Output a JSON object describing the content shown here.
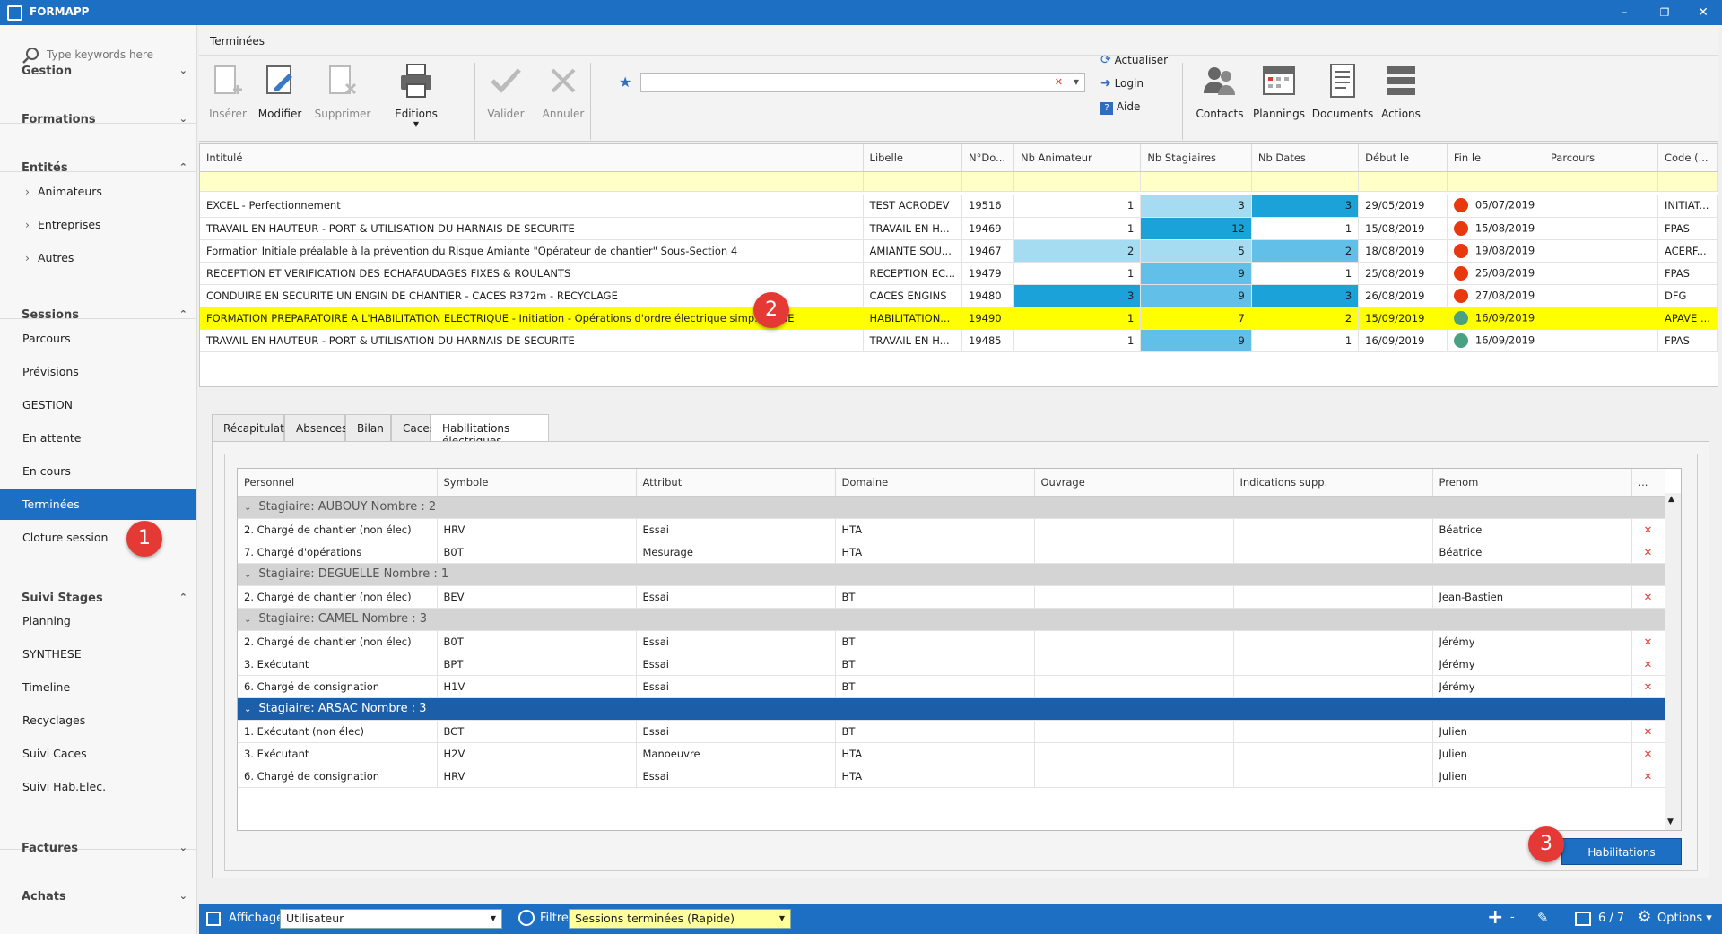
{
  "app": {
    "title": "FORMAPP",
    "window_controls": {
      "minimize": "–",
      "restore": "❐",
      "close": "✕"
    }
  },
  "sidebar": {
    "search_placeholder": "Type keywords here",
    "groups": [
      {
        "label": "Gestion",
        "state": "collapsed"
      },
      {
        "label": "Formations",
        "state": "collapsed"
      },
      {
        "label": "Entités",
        "state": "expanded",
        "items": [
          "Animateurs",
          "Entreprises",
          "Autres"
        ]
      },
      {
        "label": "Sessions",
        "state": "expanded",
        "items": [
          "Parcours",
          "Prévisions",
          "GESTION",
          "En attente",
          "En cours",
          "Terminées",
          "Cloture session"
        ]
      },
      {
        "label": "Suivi Stages",
        "state": "expanded",
        "items": [
          "Planning",
          "SYNTHESE",
          "Timeline",
          "Recyclages",
          "Suivi Caces",
          "Suivi Hab.Elec."
        ]
      },
      {
        "label": "Factures",
        "state": "collapsed"
      },
      {
        "label": "Achats",
        "state": "collapsed"
      }
    ],
    "active_item": "Terminées"
  },
  "breadcrumb": "Terminées",
  "ribbon": {
    "buttons": [
      "Insérer",
      "Modifier",
      "Supprimer",
      "Editions",
      "Valider",
      "Annuler"
    ],
    "small_actions": [
      "Actualiser",
      "Login",
      "Aide"
    ],
    "right_buttons": [
      "Contacts",
      "Plannings",
      "Documents",
      "Actions"
    ],
    "search_value": ""
  },
  "grid": {
    "columns": [
      "Intitulé",
      "Libelle",
      "N°Do...",
      "Nb Animateur",
      "Nb Stagiaires",
      "Nb Dates",
      "Début le",
      "Fin le",
      "Parcours",
      "Code (..."
    ],
    "rows": [
      {
        "intitule": "EXCEL - Perfectionnement",
        "libelle": "TEST ACRODEV",
        "no": "19516",
        "anim": "1",
        "stag": "3",
        "dates": "3",
        "debut": "29/05/2019",
        "fin": "05/07/2019",
        "status": "red",
        "parcours": "",
        "code": "INITIAT..."
      },
      {
        "intitule": "TRAVAIL EN HAUTEUR - PORT & UTILISATION DU HARNAIS DE SECURITE",
        "libelle": "TRAVAIL EN H...",
        "no": "19469",
        "anim": "1",
        "stag": "12",
        "dates": "1",
        "debut": "15/08/2019",
        "fin": "15/08/2019",
        "status": "red",
        "parcours": "",
        "code": "FPAS"
      },
      {
        "intitule": "Formation Initiale préalable à la prévention du Risque Amiante \"Opérateur de chantier\" Sous-Section 4",
        "libelle": "AMIANTE SOU...",
        "no": "19467",
        "anim": "2",
        "stag": "5",
        "dates": "2",
        "debut": "18/08/2019",
        "fin": "19/08/2019",
        "status": "red",
        "parcours": "",
        "code": "ACERF..."
      },
      {
        "intitule": "RECEPTION ET VERIFICATION DES ECHAFAUDAGES FIXES & ROULANTS",
        "libelle": "RECEPTION EC...",
        "no": "19479",
        "anim": "1",
        "stag": "9",
        "dates": "1",
        "debut": "25/08/2019",
        "fin": "25/08/2019",
        "status": "red",
        "parcours": "",
        "code": "FPAS"
      },
      {
        "intitule": "CONDUIRE EN SECURITE UN ENGIN DE CHANTIER - CACES R372m - RECYCLAGE",
        "libelle": "CACES ENGINS",
        "no": "19480",
        "anim": "3",
        "stag": "9",
        "dates": "3",
        "debut": "26/08/2019",
        "fin": "27/08/2019",
        "status": "red",
        "parcours": "",
        "code": "DFG"
      },
      {
        "intitule": "FORMATION PREPARATOIRE A L'HABILITATION ELECTRIQUE - Initiation - Opérations d'ordre électrique simp... S, BE",
        "libelle": "HABILITATION...",
        "no": "19490",
        "anim": "1",
        "stag": "7",
        "dates": "2",
        "debut": "15/09/2019",
        "fin": "16/09/2019",
        "status": "green",
        "parcours": "",
        "code": "APAVE ...",
        "selected": true
      },
      {
        "intitule": "TRAVAIL EN HAUTEUR - PORT & UTILISATION DU HARNAIS DE SECURITE",
        "libelle": "TRAVAIL EN H...",
        "no": "19485",
        "anim": "1",
        "stag": "9",
        "dates": "1",
        "debut": "16/09/2019",
        "fin": "16/09/2019",
        "status": "green",
        "parcours": "",
        "code": "FPAS"
      }
    ]
  },
  "tabs": [
    "Récapitulatif",
    "Absences",
    "Bilan",
    "Caces",
    "Habilitations électriques"
  ],
  "active_tab": "Habilitations électriques",
  "subgrid": {
    "columns": [
      "Personnel",
      "Symbole",
      "Attribut",
      "Domaine",
      "Ouvrage",
      "Indications supp.",
      "Prenom",
      "..."
    ],
    "groups": [
      {
        "label": "Stagiaire: AUBOUY Nombre : 2",
        "rows": [
          [
            "2. Chargé de chantier (non élec)",
            "HRV",
            "Essai",
            "HTA",
            "",
            "",
            "Béatrice"
          ],
          [
            "7. Chargé d'opérations",
            "B0T",
            "Mesurage",
            "HTA",
            "",
            "",
            "Béatrice"
          ]
        ]
      },
      {
        "label": "Stagiaire: DEGUELLE Nombre : 1",
        "rows": [
          [
            "2. Chargé de chantier (non élec)",
            "BEV",
            "Essai",
            "BT",
            "",
            "",
            "Jean-Bastien"
          ]
        ]
      },
      {
        "label": "Stagiaire: CAMEL Nombre : 3",
        "rows": [
          [
            "2. Chargé de chantier (non élec)",
            "B0T",
            "Essai",
            "BT",
            "",
            "",
            "Jérémy"
          ],
          [
            "3. Exécutant",
            "BPT",
            "Essai",
            "BT",
            "",
            "",
            "Jérémy"
          ],
          [
            "6. Chargé de consignation",
            "H1V",
            "Essai",
            "BT",
            "",
            "",
            "Jérémy"
          ]
        ]
      },
      {
        "label": "Stagiaire: ARSAC Nombre : 3",
        "selected": true,
        "rows": [
          [
            "1. Exécutant (non élec)",
            "BCT",
            "Essai",
            "BT",
            "",
            "",
            "Julien"
          ],
          [
            "3. Exécutant",
            "H2V",
            "Manoeuvre",
            "HTA",
            "",
            "",
            "Julien"
          ],
          [
            "6. Chargé de consignation",
            "HRV",
            "Essai",
            "HTA",
            "",
            "",
            "Julien"
          ]
        ]
      }
    ]
  },
  "habilitations_button": "Habilitations",
  "badges": [
    "1",
    "2",
    "3"
  ],
  "statusbar": {
    "affichage_label": "Affichage",
    "affichage_value": "Utilisateur",
    "filtre_label": "Filtre",
    "filtre_value": "Sessions terminées (Rapide)",
    "page_info": "6 / 7",
    "options_label": "Options"
  },
  "colors": {
    "accent": "#1c6fc2",
    "selected_row": "#ffff00",
    "status_red": "#e8380d",
    "status_green": "#4aa181",
    "cell_blue_dark": "#1aa2d9",
    "cell_blue_mid": "#62c0e8",
    "cell_blue_light": "#a6dcf2"
  }
}
